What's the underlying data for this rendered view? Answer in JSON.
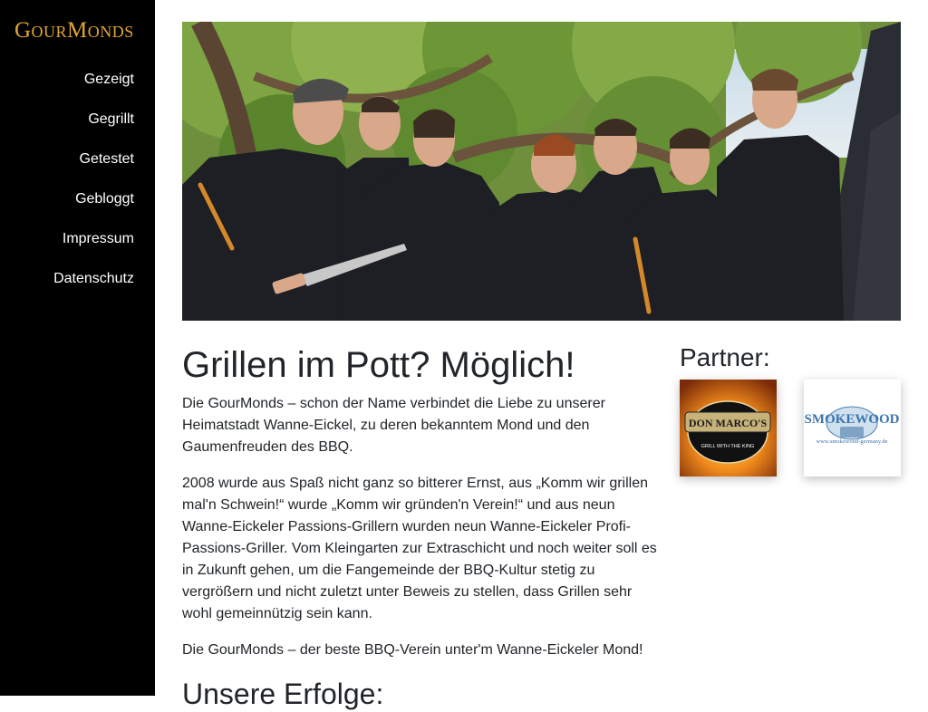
{
  "brand": {
    "name": "GourMonds"
  },
  "nav": {
    "items": [
      "Gezeigt",
      "Gegrillt",
      "Getestet",
      "Gebloggt",
      "Impressum",
      "Datenschutz"
    ]
  },
  "main": {
    "heading": "Grillen im Pott? Möglich!",
    "paragraphs": [
      "Die GourMonds – schon der Name verbindet die Liebe zu unserer Heimatstadt Wanne-Eickel, zu deren bekanntem Mond und den Gaumenfreuden des BBQ.",
      "2008 wurde aus Spaß nicht ganz so bitterer Ernst, aus „Komm wir grillen mal'n Schwein!“ wurde „Komm wir gründen'n Verein!“ und aus neun Wanne-Eickeler Passions-Grillern wurden neun Wanne-Eickeler Profi-Passions-Griller. Vom Kleingarten zur Extraschicht und noch weiter soll es in Zukunft gehen, um die Fangemeinde der BBQ-Kultur stetig zu vergrößern und nicht zuletzt unter Beweis zu stellen, dass Grillen sehr wohl gemeinnützig sein kann.",
      "Die GourMonds – der beste BBQ-Verein unter'm Wanne-Eickeler Mond!"
    ],
    "subheading": "Unsere Erfolge:"
  },
  "partners": {
    "heading": "Partner:",
    "items": [
      {
        "name": "DON MARCO'S",
        "subline": "GRILL WITH THE KING"
      },
      {
        "name": "SMOKEWOOD",
        "subline": "www.smokewood-germany.de"
      }
    ]
  },
  "colors": {
    "brand": "#e0a632",
    "sidebar": "#000000",
    "text": "#212529"
  }
}
